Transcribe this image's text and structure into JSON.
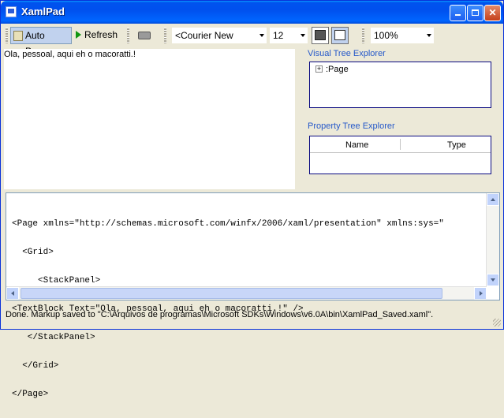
{
  "window": {
    "title": "XamlPad"
  },
  "toolbar": {
    "auto_parse_label": "Auto Parse",
    "refresh_label": "Refresh",
    "font_family": "<Courier New",
    "font_size": "12",
    "zoom": "100%"
  },
  "preview": {
    "text": "Ola, pessoal, aqui eh o macoratti.!"
  },
  "visual_tree": {
    "title": "Visual Tree Explorer",
    "root_node": ":Page",
    "expander": "+"
  },
  "property_tree": {
    "title": "Property Tree Explorer",
    "col_name": "Name",
    "col_type": "Type"
  },
  "editor": {
    "line1": "<Page xmlns=\"http://schemas.microsoft.com/winfx/2006/xaml/presentation\" xmlns:sys=\"",
    "line2": "  <Grid>",
    "line3": "     <StackPanel>",
    "line4": "<TextBlock Text=\"Ola, pessoal, aqui eh o macoratti.!\" />",
    "line5": "   </StackPanel>",
    "line6": "  </Grid>",
    "line7": "</Page>"
  },
  "status": {
    "text": "Done. Markup saved to \"C:\\Arquivos de programas\\Microsoft SDKs\\Windows\\v6.0A\\bin\\XamlPad_Saved.xaml\"."
  },
  "colors": {
    "titlebar": "#0054e3",
    "group_title": "#2558c9",
    "panel_border": "#0a0a80"
  }
}
